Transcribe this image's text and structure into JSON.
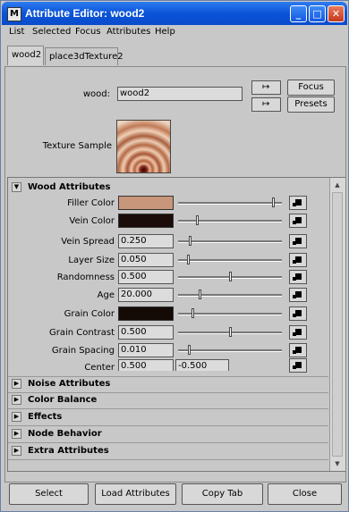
{
  "window": {
    "title": "Attribute Editor: wood2",
    "app_icon_glyph": "M"
  },
  "menu": [
    "List",
    "Selected",
    "Focus",
    "Attributes",
    "Help"
  ],
  "tabs": [
    "wood2",
    "place3dTexture2"
  ],
  "node": {
    "name_label": "wood:",
    "name_value": "wood2",
    "focus_label": "Focus",
    "presets_label": "Presets",
    "texture_sample_label": "Texture Sample"
  },
  "wood_attributes": {
    "title": "Wood Attributes",
    "filler_color": {
      "label": "Filler Color",
      "color": "#c8967a",
      "slider": 0.93
    },
    "vein_color": {
      "label": "Vein Color",
      "color": "#1a0c08",
      "slider": 0.18
    },
    "vein_spread": {
      "label": "Vein Spread",
      "value": "0.250",
      "slider": 0.11
    },
    "layer_size": {
      "label": "Layer Size",
      "value": "0.050",
      "slider": 0.09
    },
    "randomness": {
      "label": "Randomness",
      "value": "0.500",
      "slider": 0.5
    },
    "age": {
      "label": "Age",
      "value": "20.000",
      "slider": 0.2
    },
    "grain_color": {
      "label": "Grain Color",
      "color": "#140a06",
      "slider": 0.13
    },
    "grain_contrast": {
      "label": "Grain Contrast",
      "value": "0.500",
      "slider": 0.5
    },
    "grain_spacing": {
      "label": "Grain Spacing",
      "value": "0.010",
      "slider": 0.1
    },
    "center": {
      "label": "Center",
      "value_u": "0.500",
      "value_v": "-0.500"
    }
  },
  "sections": [
    "Noise Attributes",
    "Color Balance",
    "Effects",
    "Node Behavior",
    "Extra Attributes"
  ],
  "bottom_buttons": [
    "Select",
    "Load Attributes",
    "Copy Tab",
    "Close"
  ]
}
